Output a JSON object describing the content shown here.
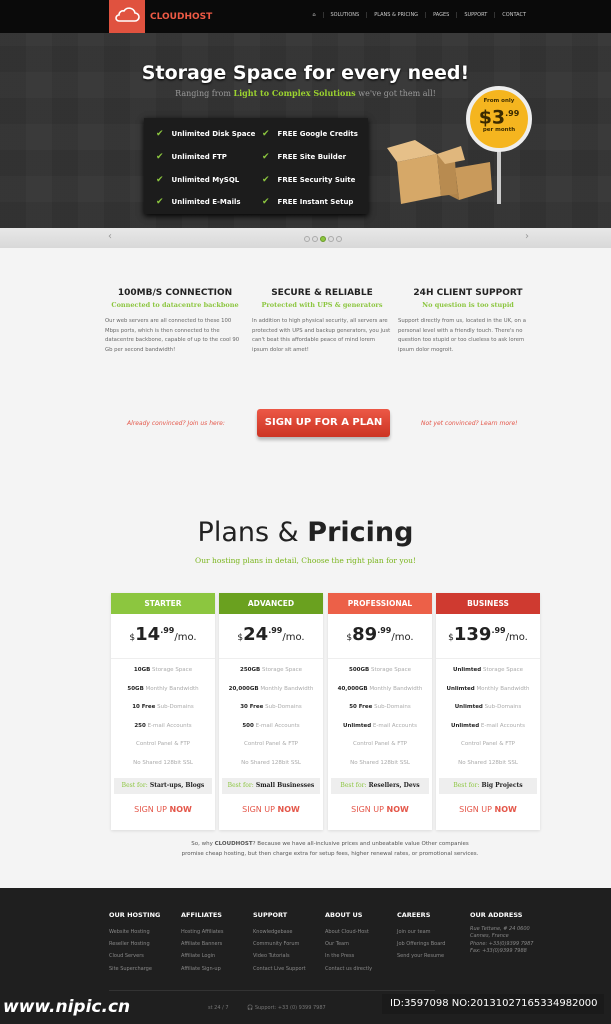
{
  "header": {
    "brand": "CLOUDHOST",
    "nav": [
      "SOLUTIONS",
      "PLANS & PRICING",
      "PAGES",
      "SUPPORT",
      "CONTACT"
    ]
  },
  "hero": {
    "title": "Storage Space for every need!",
    "subtitle_pre": "Ranging from ",
    "subtitle_hl": "Light to Complex Solutions",
    "subtitle_post": " we've got them all!",
    "features": [
      "Unlimited Disk Space",
      "FREE Google Credits",
      "Unlimited FTP",
      "FREE Site Builder",
      "Unlimited MySQL",
      "FREE Security Suite",
      "Unlimited E-Mails",
      "FREE Instant Setup"
    ],
    "badge": {
      "top": "From only",
      "price": "$3",
      "cents": ".99",
      "bottom": "per month"
    },
    "slider": {
      "active_index": 2,
      "count": 5
    }
  },
  "features": [
    {
      "title": "100MB/S CONNECTION",
      "subtitle": "Connected to datacentre backbone",
      "text": "Our web servers are all connected to these 100 Mbps ports, which is then connected to the datacentre backbone, capable of up to the cool 90 Gb per second bandwidth!"
    },
    {
      "title": "SECURE & RELIABLE",
      "subtitle": "Protected with UPS & generators",
      "text": "In addition to high physical security, all servers are protected with UPS and backup generators, you just can't beat this affordable peace of mind lorem ipsum dolor sit amet!"
    },
    {
      "title": "24H CLIENT SUPPORT",
      "subtitle": "No question is too stupid",
      "text": "Support directly from us, located in the UK, on a personal level with a friendly touch. There's no question too stupid or too clueless to ask lorem ipsum dolor mogroit."
    }
  ],
  "cta": {
    "left": "Already convinced? Join us here:",
    "button": "SIGN UP FOR A PLAN",
    "right": "Not yet convinced? Learn more!"
  },
  "plans": {
    "title_light": "Plans &",
    "title_bold": "Pricing",
    "subtitle": "Our hosting plans in detail, Choose the right plan for you!",
    "best_label": "Best for:",
    "signup_a": "SIGN UP",
    "signup_b": "NOW",
    "currency": "$",
    "period": "/mo.",
    "items": [
      {
        "name": "STARTER",
        "color": "#8cc63f",
        "price": "14",
        "cents": ".99",
        "rows": [
          [
            "10GB",
            "Storage Space"
          ],
          [
            "50GB",
            "Monthly Bandwidth"
          ],
          [
            "10 Free",
            "Sub-Domains"
          ],
          [
            "250",
            "E-mail Accounts"
          ],
          [
            "",
            "Control Panel & FTP"
          ],
          [
            "",
            "No Shared 128bit SSL"
          ]
        ],
        "best": "Start-ups, Blogs"
      },
      {
        "name": "ADVANCED",
        "color": "#6aa11f",
        "price": "24",
        "cents": ".99",
        "rows": [
          [
            "250GB",
            "Storage Space"
          ],
          [
            "20,000GB",
            "Monthly Bandwidth"
          ],
          [
            "30 Free",
            "Sub-Domains"
          ],
          [
            "500",
            "E-mail Accounts"
          ],
          [
            "",
            "Control Panel & FTP"
          ],
          [
            "",
            "No Shared 128bit SSL"
          ]
        ],
        "best": "Small Businesses"
      },
      {
        "name": "PROFESSIONAL",
        "color": "#ec6048",
        "price": "89",
        "cents": ".99",
        "rows": [
          [
            "500GB",
            "Storage Space"
          ],
          [
            "40,000GB",
            "Monthly Bandwidth"
          ],
          [
            "50 Free",
            "Sub-Domains"
          ],
          [
            "Unlimted",
            "E-mail Accounts"
          ],
          [
            "",
            "Control Panel & FTP"
          ],
          [
            "",
            "No Shared 128bit SSL"
          ]
        ],
        "best": "Resellers, Devs"
      },
      {
        "name": "BUSINESS",
        "color": "#cf3a30",
        "price": "139",
        "cents": ".99",
        "rows": [
          [
            "Unlimted",
            "Storage Space"
          ],
          [
            "Unlimted",
            "Monthly Bandwidth"
          ],
          [
            "Unlimted",
            "Sub-Domains"
          ],
          [
            "Unlimted",
            "E-mail Accounts"
          ],
          [
            "",
            "Control Panel & FTP"
          ],
          [
            "",
            "No Shared 128bit SSL"
          ]
        ],
        "best": "Big Projects"
      }
    ]
  },
  "why": {
    "pre": "So, why ",
    "brand": "CLOUDHOST",
    "post": "? Because we have all-inclusive prices and unbeatable value Other companies promise cheap hosting, but then charge extra for setup fees, higher renewal rates, or promotional services."
  },
  "footer": {
    "cols": [
      {
        "title": "OUR HOSTING",
        "links": [
          "Website Hosting",
          "Reseller Hosting",
          "Cloud Servers",
          "Site Supercharge"
        ]
      },
      {
        "title": "AFFILIATES",
        "links": [
          "Hosting Affiliates",
          "Affiliate Banners",
          "Affiliate Login",
          "Affiliate Sign-up"
        ]
      },
      {
        "title": "SUPPORT",
        "links": [
          "Knowledgebase",
          "Community Forum",
          "Video Tutorials",
          "Contact Live Support"
        ]
      },
      {
        "title": "ABOUT US",
        "links": [
          "About Cloud-Host",
          "Our Team",
          "In the Press",
          "Contact us directly"
        ]
      },
      {
        "title": "CAREERS",
        "links": [
          "Join our team",
          "Job Offerings Board",
          "Send your Resume"
        ]
      },
      {
        "title": "OUR ADDRESS",
        "links": [
          "Rue Tettane, # 24 0600",
          "Cannes, France",
          "Phone: +33(0)9399 7987",
          "Fax: +33(0)9399 7988"
        ]
      }
    ],
    "bottom_left": "st 24 / 7",
    "bottom_support": "Support: +33 (0) 9399 7987"
  },
  "watermark": {
    "site": "www.nipic.cn",
    "id": "ID:3597098 NO:20131027165334982000"
  }
}
